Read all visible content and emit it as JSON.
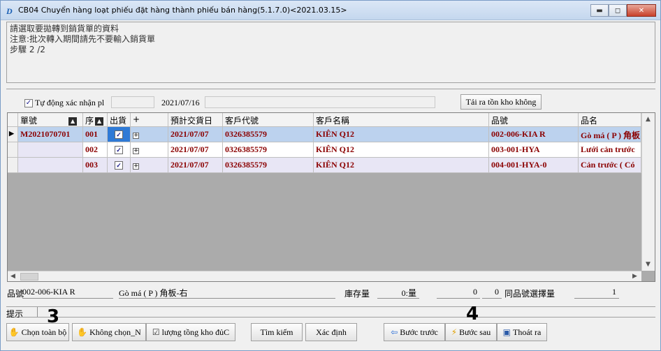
{
  "window": {
    "title": "CB04 Chuyển hàng loạt phiếu đặt hàng thành phiếu bán hàng(5.1.7.0)<2021.03.15>",
    "icon": "app-d-icon",
    "minimize_label": "▬",
    "maximize_label": "◻",
    "close_label": "✕"
  },
  "info": {
    "line1": "請選取要拋轉到銷貨單的資料",
    "line2": "注意:批次轉入期間請先不要輸入銷貨單",
    "line3": "步驟 2 /2"
  },
  "toolbar": {
    "auto_confirm_label": "Tự động xác nhận pl",
    "auto_confirm_checked": true,
    "checkmark": "✓",
    "date": "2021/07/16",
    "reload_label": "Tải ra tồn kho không"
  },
  "grid": {
    "headers": {
      "order_no": "單號",
      "seq": "序",
      "ship": "出貨",
      "expand": "+",
      "delivery_date": "預計交貨日",
      "customer_code": "客戶代號",
      "customer_name": "客戶名稱",
      "item_no": "品號",
      "item_name": "品名"
    },
    "sort_glyph": "▲",
    "row_indicator": "▶",
    "expander_glyph": "+",
    "rows": [
      {
        "order_no": "M2021070701",
        "seq": "001",
        "ship": true,
        "delivery_date": "2021/07/07",
        "customer_code": "0326385579",
        "customer_name": "KIÊN Q12",
        "item_no": "002-006-KIA R",
        "item_name": "Gò má ( P ) 角板"
      },
      {
        "order_no": "",
        "seq": "002",
        "ship": true,
        "delivery_date": "2021/07/07",
        "customer_code": "0326385579",
        "customer_name": "KIÊN Q12",
        "item_no": "003-001-HYA",
        "item_name": "Lưới cản trước"
      },
      {
        "order_no": "",
        "seq": "003",
        "ship": true,
        "delivery_date": "2021/07/07",
        "customer_code": "0326385579",
        "customer_name": "KIÊN Q12",
        "item_no": "004-001-HYA-0",
        "item_name": "Cản trước ( Có"
      }
    ],
    "scroll_up": "▲",
    "scroll_down": "▼",
    "scroll_left": "◀",
    "scroll_right": "▶"
  },
  "status": {
    "item_no_label": "品號",
    "item_no_value": "002-006-KIA R",
    "item_name_value": "Gò má ( P ) 角板-右",
    "stock_label": "庫存量",
    "stock_value": "0",
    "stock_extra": "0:量",
    "zero_value": "0",
    "same_item_label": "同品號選擇量",
    "same_item_value": "1"
  },
  "hint": {
    "label": "提示"
  },
  "buttons": {
    "select_all": "Chọn toàn bộ",
    "deselect": "Không chọn_N",
    "stock_total": "lượng tồng kho đủC",
    "search": "Tìm kiếm",
    "confirm": "Xác định",
    "prev": "Bước trước",
    "next": "Bước sau",
    "exit": "Thoát ra"
  },
  "markers": {
    "m3": "3",
    "m4": "4"
  },
  "colors": {
    "selected_row": "#bcd2ee",
    "alt_row": "#e8e6f5",
    "data_text": "#8b0000",
    "header_bg": "#f3f3f3"
  }
}
